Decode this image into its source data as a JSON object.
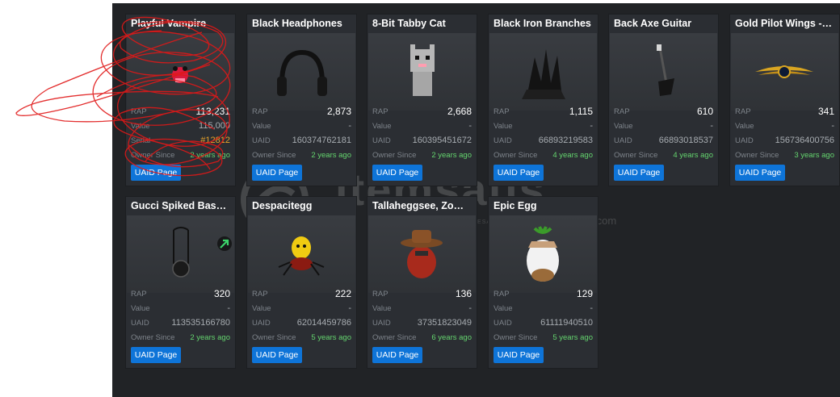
{
  "labels": {
    "rap": "RAP",
    "value": "Value",
    "serial": "Serial",
    "uaid": "UAID",
    "owner_since": "Owner Since",
    "button": "UAID Page"
  },
  "items": [
    {
      "name": "Playful Vampire",
      "rap": "113,231",
      "value": "115,000",
      "serial": "#12812",
      "uaid": "",
      "owner_since": "2 years ago",
      "icon": "vampire-face"
    },
    {
      "name": "Black Headphones",
      "rap": "2,873",
      "value": "-",
      "uaid": "160374762181",
      "owner_since": "2 years ago",
      "icon": "headphones"
    },
    {
      "name": "8-Bit Tabby Cat",
      "rap": "2,668",
      "value": "-",
      "uaid": "160395451672",
      "owner_since": "2 years ago",
      "icon": "pixel-cat"
    },
    {
      "name": "Black Iron Branches",
      "rap": "1,115",
      "value": "-",
      "uaid": "66893219583",
      "owner_since": "4 years ago",
      "icon": "branches"
    },
    {
      "name": "Back Axe Guitar",
      "rap": "610",
      "value": "-",
      "uaid": "66893018537",
      "owner_since": "4 years ago",
      "icon": "axe-guitar"
    },
    {
      "name": "Gold Pilot Wings - T...",
      "rap": "341",
      "value": "-",
      "uaid": "156736400756",
      "owner_since": "3 years ago",
      "icon": "pilot-wings"
    },
    {
      "name": "Gucci Spiked Basket...",
      "rap": "320",
      "value": "-",
      "uaid": "113535166780",
      "owner_since": "2 years ago",
      "icon": "spiked-basket",
      "trend": "trend-up-icon"
    },
    {
      "name": "Despacitegg",
      "rap": "222",
      "value": "-",
      "uaid": "62014459786",
      "owner_since": "5 years ago",
      "icon": "spider-egg"
    },
    {
      "name": "Tallaheggsee, Zombi...",
      "rap": "136",
      "value": "-",
      "uaid": "37351823049",
      "owner_since": "6 years ago",
      "icon": "cowboy-egg"
    },
    {
      "name": "Epic Egg",
      "rap": "129",
      "value": "-",
      "uaid": "61111940510",
      "owner_since": "5 years ago",
      "icon": "epic-egg"
    }
  ],
  "watermark": {
    "text": "itemsatis",
    "domain": ".com",
    "tagline": "HESAP / SKIN / KOD / E-PIN"
  },
  "colors": {
    "panel": "#212326",
    "card": "#2b2e33",
    "button": "#0e74d8",
    "owner_since": "#64d46e",
    "serial": "#e7a32a",
    "scribble": "#e01818"
  }
}
